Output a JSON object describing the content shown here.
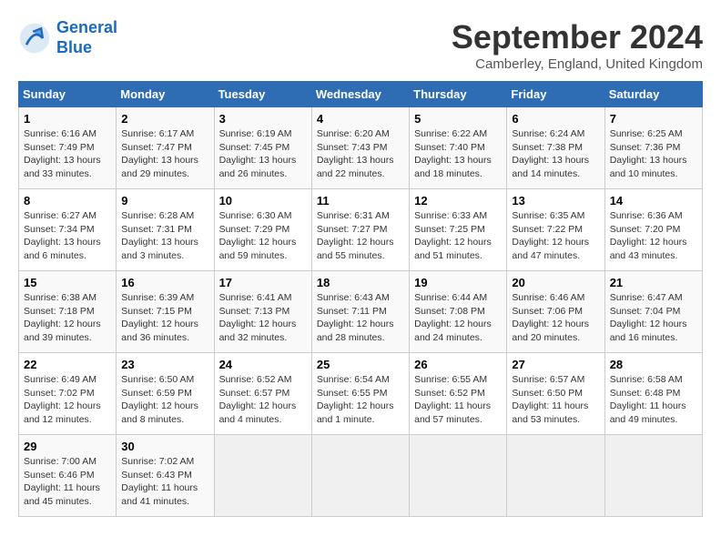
{
  "logo": {
    "line1": "General",
    "line2": "Blue"
  },
  "title": "September 2024",
  "location": "Camberley, England, United Kingdom",
  "days_header": [
    "Sunday",
    "Monday",
    "Tuesday",
    "Wednesday",
    "Thursday",
    "Friday",
    "Saturday"
  ],
  "weeks": [
    [
      {
        "num": "1",
        "sunrise": "6:16 AM",
        "sunset": "7:49 PM",
        "daylight": "13 hours and 33 minutes."
      },
      {
        "num": "2",
        "sunrise": "6:17 AM",
        "sunset": "7:47 PM",
        "daylight": "13 hours and 29 minutes."
      },
      {
        "num": "3",
        "sunrise": "6:19 AM",
        "sunset": "7:45 PM",
        "daylight": "13 hours and 26 minutes."
      },
      {
        "num": "4",
        "sunrise": "6:20 AM",
        "sunset": "7:43 PM",
        "daylight": "13 hours and 22 minutes."
      },
      {
        "num": "5",
        "sunrise": "6:22 AM",
        "sunset": "7:40 PM",
        "daylight": "13 hours and 18 minutes."
      },
      {
        "num": "6",
        "sunrise": "6:24 AM",
        "sunset": "7:38 PM",
        "daylight": "13 hours and 14 minutes."
      },
      {
        "num": "7",
        "sunrise": "6:25 AM",
        "sunset": "7:36 PM",
        "daylight": "13 hours and 10 minutes."
      }
    ],
    [
      {
        "num": "8",
        "sunrise": "6:27 AM",
        "sunset": "7:34 PM",
        "daylight": "13 hours and 6 minutes."
      },
      {
        "num": "9",
        "sunrise": "6:28 AM",
        "sunset": "7:31 PM",
        "daylight": "13 hours and 3 minutes."
      },
      {
        "num": "10",
        "sunrise": "6:30 AM",
        "sunset": "7:29 PM",
        "daylight": "12 hours and 59 minutes."
      },
      {
        "num": "11",
        "sunrise": "6:31 AM",
        "sunset": "7:27 PM",
        "daylight": "12 hours and 55 minutes."
      },
      {
        "num": "12",
        "sunrise": "6:33 AM",
        "sunset": "7:25 PM",
        "daylight": "12 hours and 51 minutes."
      },
      {
        "num": "13",
        "sunrise": "6:35 AM",
        "sunset": "7:22 PM",
        "daylight": "12 hours and 47 minutes."
      },
      {
        "num": "14",
        "sunrise": "6:36 AM",
        "sunset": "7:20 PM",
        "daylight": "12 hours and 43 minutes."
      }
    ],
    [
      {
        "num": "15",
        "sunrise": "6:38 AM",
        "sunset": "7:18 PM",
        "daylight": "12 hours and 39 minutes."
      },
      {
        "num": "16",
        "sunrise": "6:39 AM",
        "sunset": "7:15 PM",
        "daylight": "12 hours and 36 minutes."
      },
      {
        "num": "17",
        "sunrise": "6:41 AM",
        "sunset": "7:13 PM",
        "daylight": "12 hours and 32 minutes."
      },
      {
        "num": "18",
        "sunrise": "6:43 AM",
        "sunset": "7:11 PM",
        "daylight": "12 hours and 28 minutes."
      },
      {
        "num": "19",
        "sunrise": "6:44 AM",
        "sunset": "7:08 PM",
        "daylight": "12 hours and 24 minutes."
      },
      {
        "num": "20",
        "sunrise": "6:46 AM",
        "sunset": "7:06 PM",
        "daylight": "12 hours and 20 minutes."
      },
      {
        "num": "21",
        "sunrise": "6:47 AM",
        "sunset": "7:04 PM",
        "daylight": "12 hours and 16 minutes."
      }
    ],
    [
      {
        "num": "22",
        "sunrise": "6:49 AM",
        "sunset": "7:02 PM",
        "daylight": "12 hours and 12 minutes."
      },
      {
        "num": "23",
        "sunrise": "6:50 AM",
        "sunset": "6:59 PM",
        "daylight": "12 hours and 8 minutes."
      },
      {
        "num": "24",
        "sunrise": "6:52 AM",
        "sunset": "6:57 PM",
        "daylight": "12 hours and 4 minutes."
      },
      {
        "num": "25",
        "sunrise": "6:54 AM",
        "sunset": "6:55 PM",
        "daylight": "12 hours and 1 minute."
      },
      {
        "num": "26",
        "sunrise": "6:55 AM",
        "sunset": "6:52 PM",
        "daylight": "11 hours and 57 minutes."
      },
      {
        "num": "27",
        "sunrise": "6:57 AM",
        "sunset": "6:50 PM",
        "daylight": "11 hours and 53 minutes."
      },
      {
        "num": "28",
        "sunrise": "6:58 AM",
        "sunset": "6:48 PM",
        "daylight": "11 hours and 49 minutes."
      }
    ],
    [
      {
        "num": "29",
        "sunrise": "7:00 AM",
        "sunset": "6:46 PM",
        "daylight": "11 hours and 45 minutes."
      },
      {
        "num": "30",
        "sunrise": "7:02 AM",
        "sunset": "6:43 PM",
        "daylight": "11 hours and 41 minutes."
      },
      null,
      null,
      null,
      null,
      null
    ]
  ]
}
